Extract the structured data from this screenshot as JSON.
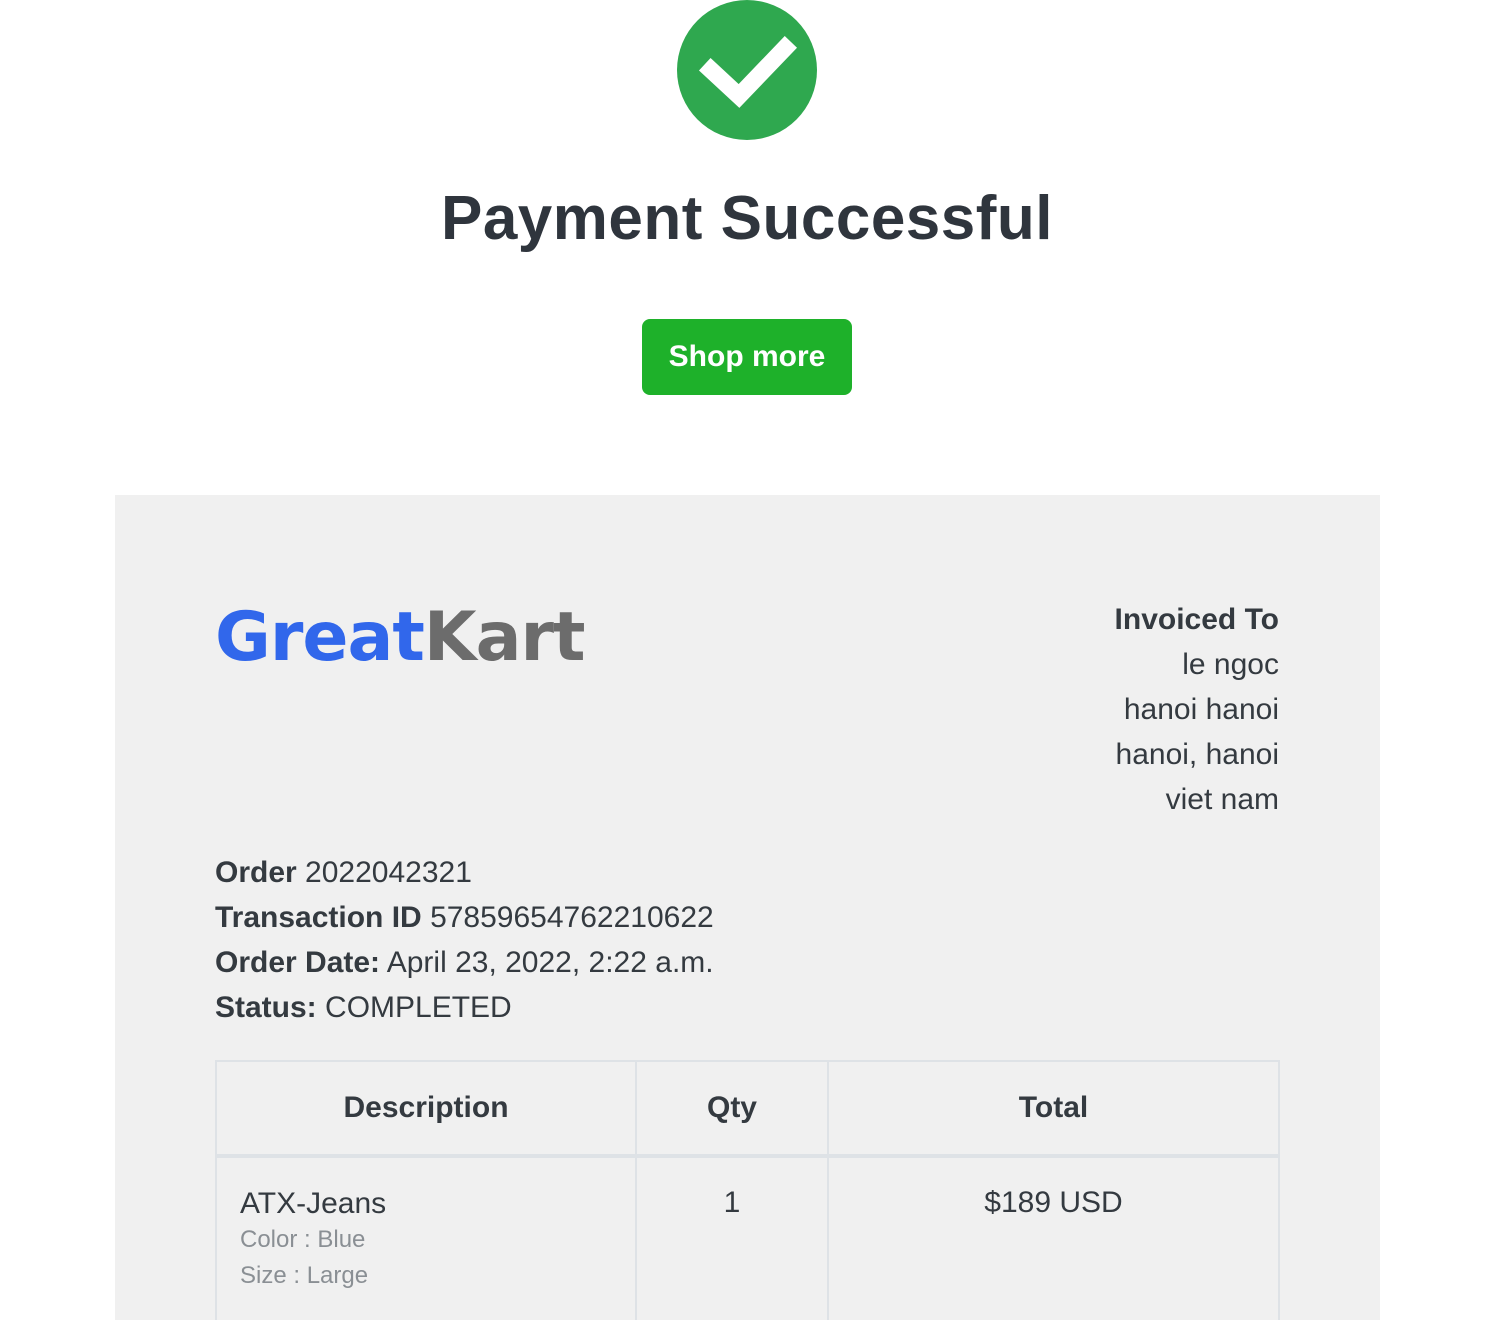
{
  "header": {
    "title": "Payment Successful",
    "shop_more_label": "Shop more",
    "success_icon": "check-circle-icon",
    "accent_color": "#2fa84f",
    "button_color": "#1eb12a"
  },
  "invoice": {
    "logo": {
      "part1": "Great",
      "part2": "Kart",
      "part1_color": "#3167eb",
      "part2_color": "#6c6c6c"
    },
    "invoiced_to": {
      "heading": "Invoiced To",
      "name": "le ngoc",
      "address_line1": "hanoi hanoi",
      "address_line2": "hanoi, hanoi",
      "country": "viet nam"
    },
    "order": {
      "order_label": "Order",
      "order_number": "2022042321",
      "transaction_label": "Transaction ID",
      "transaction_id": "57859654762210622",
      "date_label": "Order Date:",
      "date": "April 23, 2022, 2:22 a.m.",
      "status_label": "Status:",
      "status": "COMPLETED"
    },
    "table": {
      "headers": [
        "Description",
        "Qty",
        "Total"
      ],
      "rows": [
        {
          "name": "ATX-Jeans",
          "color": "Color : Blue",
          "size": "Size : Large",
          "qty": "1",
          "total": "$189 USD"
        }
      ]
    }
  }
}
